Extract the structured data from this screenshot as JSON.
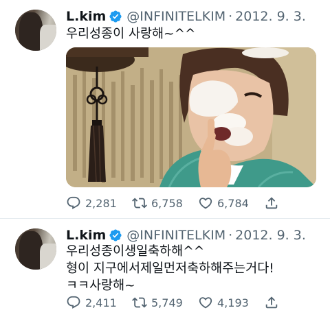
{
  "tweets": [
    {
      "name": "L.kim",
      "handle": "@INFINITELKIM",
      "separator": "·",
      "date": "2012. 9. 3.",
      "lines": [
        "우리성종이 사랑해~^^"
      ],
      "has_photo": true,
      "replies": "2,281",
      "retweets": "6,758",
      "likes": "6,784"
    },
    {
      "name": "L.kim",
      "handle": "@INFINITELKIM",
      "separator": "·",
      "date": "2012. 9. 3.",
      "lines": [
        "우리성종이생일축하해^^",
        "형이 지구에서제일먼저축하해주는거다!",
        "ㅋㅋ사랑해~"
      ],
      "has_photo": false,
      "replies": "2,411",
      "retweets": "5,749",
      "likes": "4,193"
    }
  ],
  "icons": {
    "verified": "verified-badge-icon",
    "reply": "reply-icon",
    "retweet": "retweet-icon",
    "like": "heart-icon",
    "share": "share-icon"
  },
  "colors": {
    "verified_blue": "#1d9bf0",
    "secondary_text": "#536471",
    "primary_text": "#0f1419",
    "divider": "#e6ecf0"
  }
}
